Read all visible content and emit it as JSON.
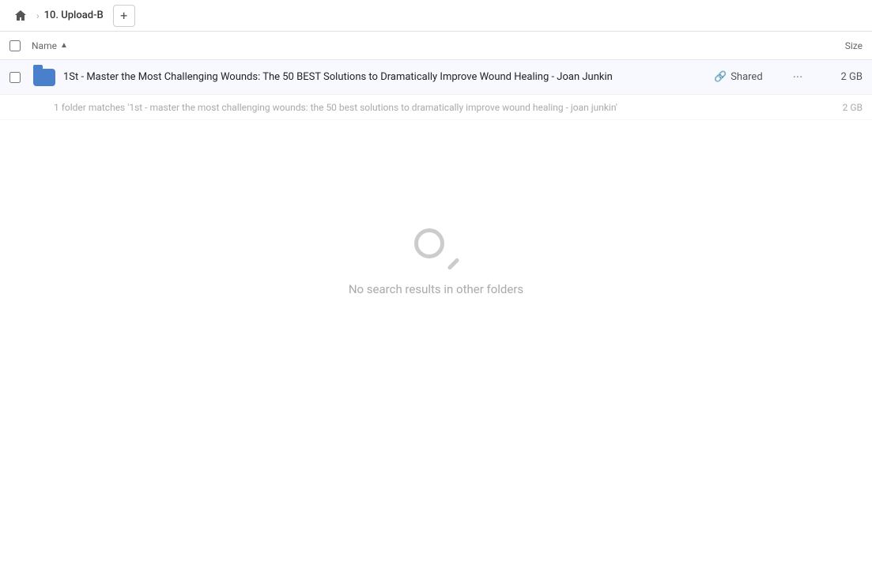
{
  "topbar": {
    "home_icon": "home",
    "breadcrumb_sep": "›",
    "folder_name": "10. Upload-B",
    "add_icon": "+"
  },
  "columns": {
    "name_label": "Name",
    "sort_arrow": "▲",
    "size_label": "Size"
  },
  "file_row": {
    "name": "1St - Master the Most Challenging Wounds: The 50 BEST Solutions to Dramatically Improve Wound Healing - Joan Junkin",
    "shared_label": "Shared",
    "more_icon": "···",
    "size": "2 GB",
    "link_icon": "🔗"
  },
  "match_row": {
    "text": "1 folder matches '1st - master the most challenging wounds: the 50 best solutions to dramatically improve wound healing - joan junkin'",
    "size": "2 GB"
  },
  "empty_state": {
    "message": "No search results in other folders"
  }
}
